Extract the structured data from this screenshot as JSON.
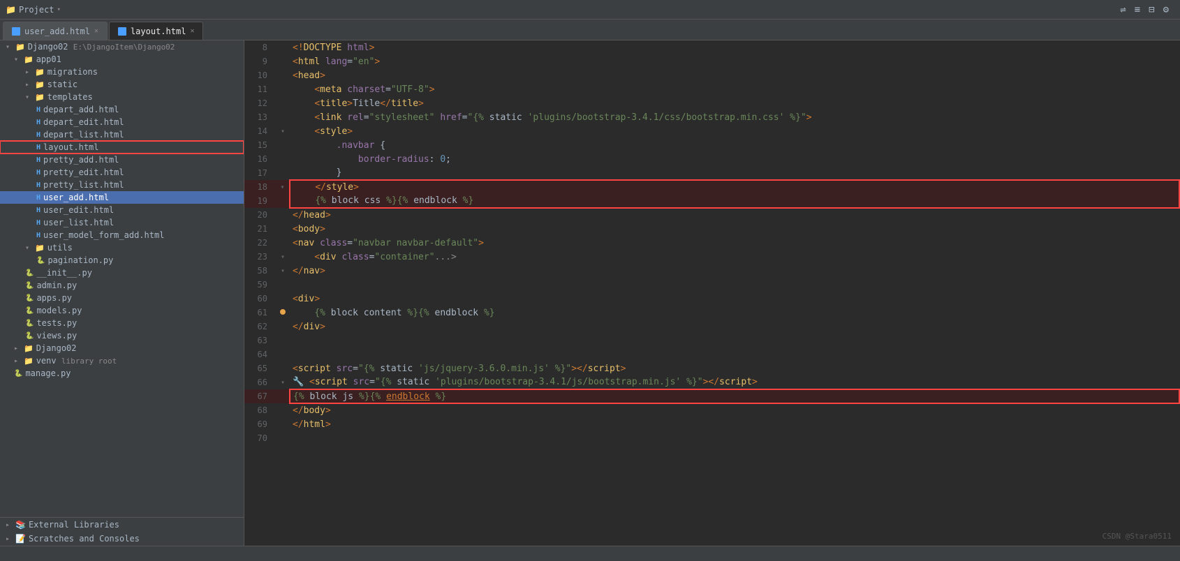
{
  "titleBar": {
    "projectLabel": "Project",
    "toolIcons": [
      "reformat",
      "sort",
      "collapse",
      "settings"
    ]
  },
  "tabs": [
    {
      "id": "user_add",
      "label": "user_add.html",
      "active": false
    },
    {
      "id": "layout",
      "label": "layout.html",
      "active": true
    }
  ],
  "sidebar": {
    "rootLabel": "Django02",
    "rootPath": "E:\\DjangoItem\\Django02",
    "app01": {
      "label": "app01",
      "children": {
        "migrations": "migrations",
        "static": "static",
        "templates": {
          "label": "templates",
          "files": [
            "depart_add.html",
            "depart_edit.html",
            "depart_list.html",
            "layout.html",
            "pretty_add.html",
            "pretty_edit.html",
            "pretty_list.html",
            "user_add.html",
            "user_edit.html",
            "user_list.html",
            "user_model_form_add.html"
          ]
        },
        "utils": {
          "label": "utils",
          "files": [
            "pagination.py"
          ]
        },
        "pyFiles": [
          "__init__.py",
          "admin.py",
          "apps.py",
          "models.py",
          "tests.py",
          "views.py"
        ]
      }
    },
    "django02": "Django02",
    "venv": "venv  library root",
    "manage": "manage.py",
    "externalLibraries": "External Libraries",
    "scratchesAndConsoles": "Scratches and Consoles"
  },
  "codeLines": [
    {
      "num": 8,
      "gutter": "",
      "content": "<!DOCTYPE html>"
    },
    {
      "num": 9,
      "gutter": "",
      "content": "<html lang=\"en\">"
    },
    {
      "num": 10,
      "gutter": "",
      "content": "<head>"
    },
    {
      "num": 11,
      "gutter": "",
      "content": "    <meta charset=\"UTF-8\">"
    },
    {
      "num": 12,
      "gutter": "",
      "content": "    <title>Title</title>"
    },
    {
      "num": 13,
      "gutter": "",
      "content": "    <link rel=\"stylesheet\" href=\"{% static 'plugins/bootstrap-3.4.1/css/bootstrap.min.css' %}\">"
    },
    {
      "num": 14,
      "gutter": "fold",
      "content": "    <style>"
    },
    {
      "num": 15,
      "gutter": "",
      "content": "        .navbar {"
    },
    {
      "num": 16,
      "gutter": "",
      "content": "            border-radius: 0;"
    },
    {
      "num": 17,
      "gutter": "",
      "content": "        }"
    },
    {
      "num": 18,
      "gutter": "fold",
      "content": "    </style>",
      "boxed": true
    },
    {
      "num": 19,
      "gutter": "",
      "content": "    {% block css %}{% endblock %}",
      "boxed": true
    },
    {
      "num": 20,
      "gutter": "",
      "content": "</head>"
    },
    {
      "num": 21,
      "gutter": "",
      "content": "<body>"
    },
    {
      "num": 22,
      "gutter": "",
      "content": "<nav class=\"navbar navbar-default\">"
    },
    {
      "num": 23,
      "gutter": "fold",
      "content": "    <div class=\"container\"...>"
    },
    {
      "num": 58,
      "gutter": "fold",
      "content": "</nav>"
    },
    {
      "num": 59,
      "gutter": "",
      "content": ""
    },
    {
      "num": 60,
      "gutter": "",
      "content": "<div>"
    },
    {
      "num": 61,
      "gutter": "bullet",
      "content": "    {% block content %}{% endblock %}"
    },
    {
      "num": 62,
      "gutter": "",
      "content": "</div>"
    },
    {
      "num": 63,
      "gutter": "",
      "content": ""
    },
    {
      "num": 64,
      "gutter": "",
      "content": ""
    },
    {
      "num": 65,
      "gutter": "",
      "content": "<script src=\"{% static 'js/jquery-3.6.0.min.js' %}\"><\\/script>"
    },
    {
      "num": 66,
      "gutter": "fold",
      "content": "<script src=\"{% static 'plugins/bootstrap-3.4.1/js/bootstrap.min.js' %}\"><\\/script>"
    },
    {
      "num": 67,
      "gutter": "",
      "content": "{% block js %}{% endblock %}",
      "boxed2": true
    },
    {
      "num": 68,
      "gutter": "",
      "content": "</body>"
    },
    {
      "num": 69,
      "gutter": "",
      "content": "</html>"
    },
    {
      "num": 70,
      "gutter": "",
      "content": ""
    }
  ],
  "watermark": "CSDN @Stara0511"
}
